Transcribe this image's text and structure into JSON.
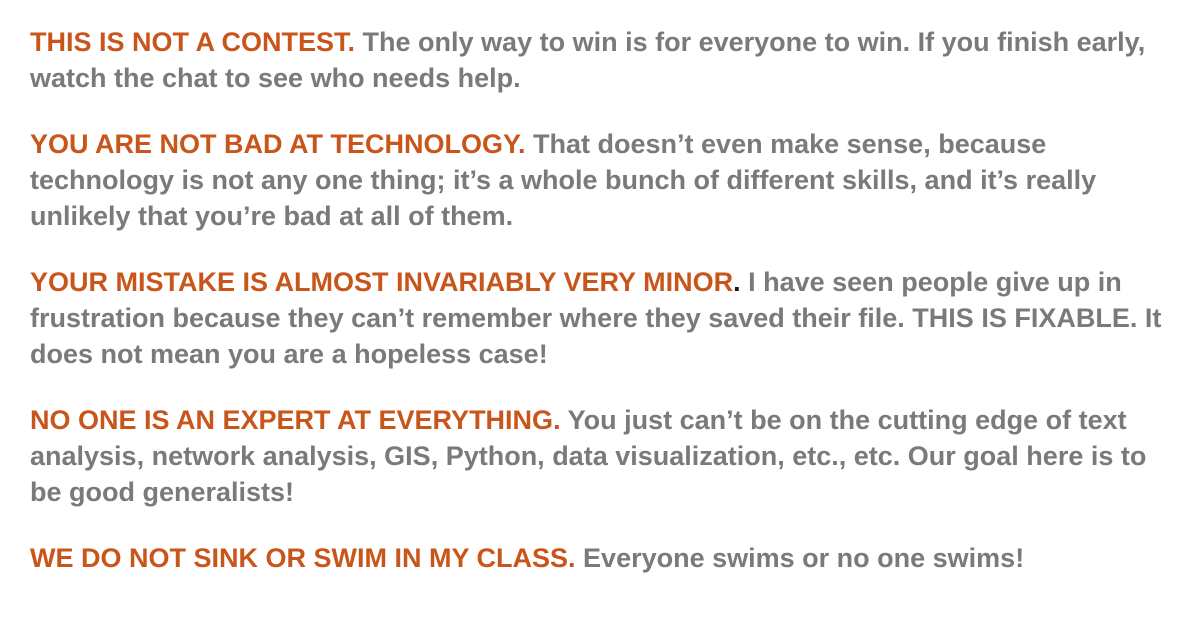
{
  "colors": {
    "heading": "#c8551a",
    "body": "#7a7a7a",
    "dark_period": "#1a1a1a",
    "background": "#ffffff"
  },
  "rules": [
    {
      "heading": "THIS IS NOT A CONTEST",
      "heading_end": ".",
      "text": "The only way to win is for everyone to win. If you finish early, watch the chat to see who needs help."
    },
    {
      "heading": "YOU ARE NOT BAD AT TECHNOLOGY",
      "heading_end": ".",
      "text": "That doesn’t even make sense, because technology is not any one thing; it’s a whole bunch of different skills, and it’s really unlikely that you’re bad at all of them."
    },
    {
      "heading": "YOUR MISTAKE IS ALMOST INVARIABLY VERY MINOR",
      "heading_end": ".",
      "text": "I have seen people give up in frustration because they can’t remember where they saved their file. THIS IS FIXABLE. It does not mean you are a hopeless case!"
    },
    {
      "heading": "NO ONE IS AN EXPERT AT EVERYTHING",
      "heading_end": ".",
      "text": "You just can’t be on the cutting edge of text analysis, network analysis, GIS, Python, data visualization, etc., etc. Our goal here is to be good generalists!"
    },
    {
      "heading": "WE DO NOT SINK OR SWIM IN MY CLASS",
      "heading_end": ".",
      "text": "Everyone swims or no one swims!"
    }
  ]
}
